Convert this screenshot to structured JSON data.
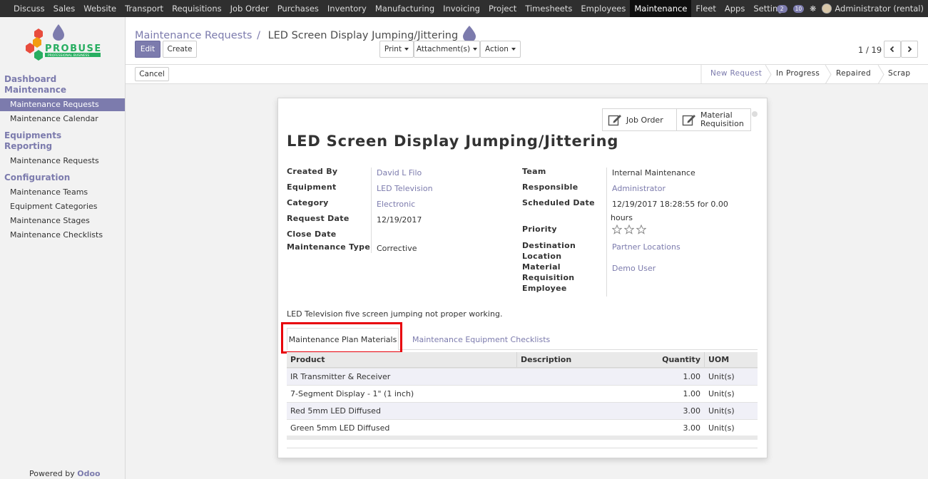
{
  "topnav": {
    "menu": [
      "Discuss",
      "Sales",
      "Website",
      "Transport",
      "Requisitions",
      "Job Order",
      "Purchases",
      "Inventory",
      "Manufacturing",
      "Invoicing",
      "Project",
      "Timesheets",
      "Employees",
      "Maintenance",
      "Fleet",
      "Apps",
      "Settings"
    ],
    "active_index": 13,
    "messages_count": "2",
    "activity_count": "10",
    "user": "Administrator (rental)"
  },
  "sidebar": {
    "logo_text": "PROBUSE",
    "logo_subtext": "PROFESSIONAL BUSINESS",
    "sections": [
      {
        "title_lines": [
          "Dashboard",
          "Maintenance"
        ],
        "items": [
          "Maintenance Requests",
          "Maintenance Calendar"
        ]
      },
      {
        "title_lines": [
          "Equipments",
          "Reporting"
        ],
        "items": [
          "Maintenance Requests"
        ]
      },
      {
        "title_lines": [
          "Configuration"
        ],
        "items": [
          "Maintenance Teams",
          "Equipment Categories",
          "Maintenance Stages",
          "Maintenance Checklists"
        ]
      }
    ],
    "powered_prefix": "Powered by",
    "powered_brand": "Odoo"
  },
  "breadcrumb": {
    "parent": "Maintenance Requests",
    "separator": "/",
    "current": "LED Screen Display Jumping/Jittering"
  },
  "buttons": {
    "edit": "Edit",
    "create": "Create",
    "print": "Print",
    "attachments": "Attachment(s)",
    "action": "Action",
    "cancel": "Cancel"
  },
  "pager": {
    "text": "1 / 19"
  },
  "stages": [
    "New Request",
    "In Progress",
    "Repaired",
    "Scrap"
  ],
  "active_stage": "New Request",
  "smart_buttons": {
    "job_order": "Job Order",
    "material_req_line1": "Material",
    "material_req_line2": "Requisition"
  },
  "record": {
    "title": "LED Screen Display Jumping/Jittering",
    "left_fields": [
      {
        "label": "Created By",
        "value": "David L Filo",
        "link": true
      },
      {
        "label": "Equipment",
        "value": "LED Television",
        "link": true
      },
      {
        "label": "Category",
        "value": "Electronic",
        "link": true
      },
      {
        "label": "Request Date",
        "value": "12/19/2017",
        "link": false
      },
      {
        "label": "Close Date",
        "value": "",
        "link": false
      },
      {
        "label": "Maintenance Type",
        "value": "Corrective",
        "link": false
      }
    ],
    "right_labels": {
      "team": "Team",
      "responsible": "Responsible",
      "scheduled": "Scheduled Date",
      "priority": "Priority",
      "dest1": "Destination",
      "dest2": "Location",
      "mat1": "Material",
      "mat2": "Requisition",
      "mat3": "Employee"
    },
    "right_values": {
      "team": "Internal Maintenance",
      "responsible": "Administrator",
      "scheduled_line1": "12/19/2017 18:28:55 for 0.00",
      "scheduled_line2": "hours",
      "priority_stars": 0,
      "destination": "Partner Locations",
      "employee": "Demo User"
    },
    "description": "LED Television five screen jumping not proper working."
  },
  "tabs": {
    "active": "Maintenance Plan Materials",
    "other": "Maintenance Equipment Checklists"
  },
  "table": {
    "headers": [
      "Product",
      "Description",
      "Quantity",
      "UOM"
    ],
    "rows": [
      {
        "product": "IR Transmitter & Receiver",
        "description": "",
        "quantity": "1.00",
        "uom": "Unit(s)"
      },
      {
        "product": "7-Segment Display - 1\" (1 inch)",
        "description": "",
        "quantity": "1.00",
        "uom": "Unit(s)"
      },
      {
        "product": "Red 5mm LED Diffused",
        "description": "",
        "quantity": "3.00",
        "uom": "Unit(s)"
      },
      {
        "product": "Green 5mm LED Diffused",
        "description": "",
        "quantity": "3.00",
        "uom": "Unit(s)"
      }
    ]
  },
  "colors": {
    "brand": "#7c7bad",
    "highlight": "#e8000a",
    "topbar": "#2f2f2f"
  }
}
